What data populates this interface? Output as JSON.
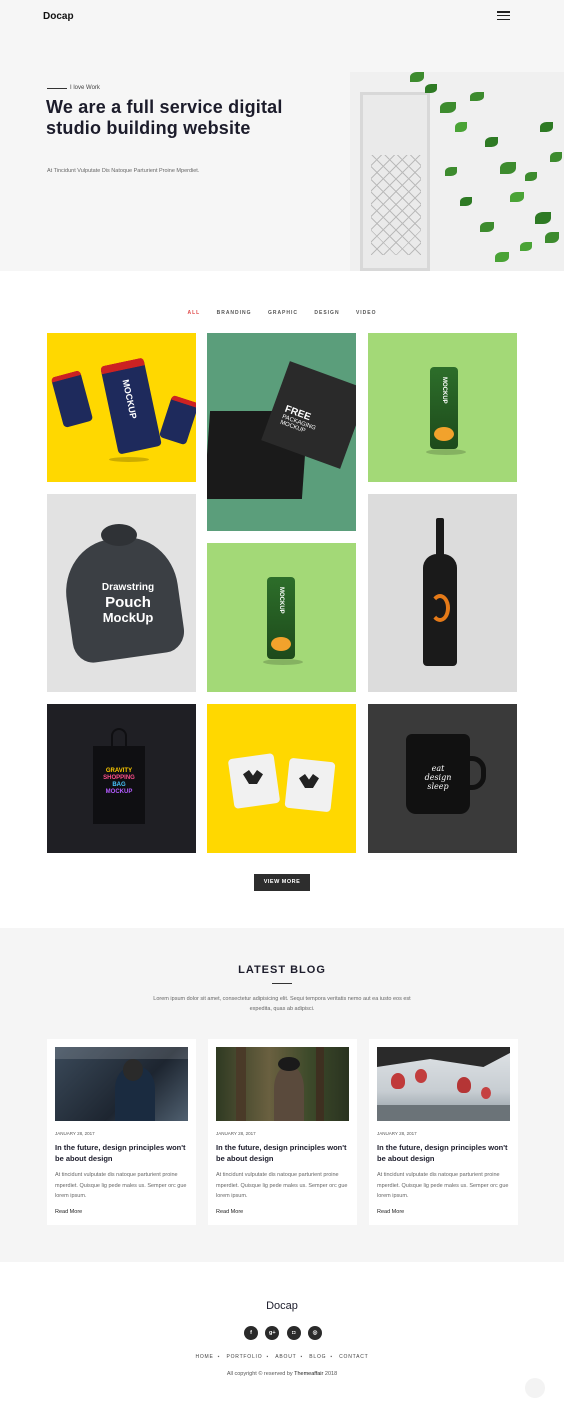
{
  "header": {
    "logo": "Docap",
    "menu_icon": "hamburger-icon"
  },
  "hero": {
    "eyebrow": "I love Work",
    "title": "We are a full service digital studio building website",
    "subtitle": "At Tincidunt Vulputate Dis Natoque Parturient Proine Mperdiet."
  },
  "portfolio": {
    "filters": [
      "ALL",
      "BRANDING",
      "GRAPHIC",
      "DESIGN",
      "VIDEO"
    ],
    "active_filter": "ALL",
    "items": [
      {
        "label_1": "MOCKUP",
        "label_2": "CAN"
      },
      {
        "label_1": "FREE",
        "label_2": "PACKAGING",
        "label_3": "MOCKUP"
      },
      {
        "label_1": "CAN",
        "label_2": "MOCKUP"
      },
      {
        "label_1": "Drawstring",
        "label_2": "Pouch",
        "label_3": "MockUp"
      },
      {
        "label_1": "CAN",
        "label_2": "MOCKUP"
      },
      {
        "label_1": ""
      },
      {
        "label_1": "GRAVITY",
        "label_2": "SHOPPING",
        "label_3": "BAG",
        "label_4": "MOCKUP"
      },
      {
        "label_1": ""
      },
      {
        "label_1": "eat",
        "label_2": "design",
        "label_3": "sleep"
      }
    ],
    "view_more": "VIEW MORE"
  },
  "blog": {
    "title": "LATEST BLOG",
    "description": "Lorem ipsum dolor sit amet, consectetur adipisicing elit. Sequi tempora veritatis nemo aut ea iusto eos est expedita, quas ab adipisci.",
    "posts": [
      {
        "date": "JANUARY 28, 2017",
        "title": "In the future, design principles won't be about design",
        "excerpt": "At tincidunt vulputate dis natoque parturient proine mperdiet. Quisque lig pede males us. Semper orc gue lorem ipsum.",
        "read_more": "Read More"
      },
      {
        "date": "JANUARY 28, 2017",
        "title": "In the future, design principles won't be about design",
        "excerpt": "At tincidunt vulputate dis natoque parturient proine mperdiet. Quisque lig pede males us. Semper orc gue lorem ipsum.",
        "read_more": "Read More"
      },
      {
        "date": "JANUARY 28, 2017",
        "title": "In the future, design principles won't be about design",
        "excerpt": "At tincidunt vulputate dis natoque parturient proine mperdiet. Quisque lig pede males us. Semper orc gue lorem ipsum.",
        "read_more": "Read More"
      }
    ]
  },
  "footer": {
    "logo": "Docap",
    "socials": [
      {
        "icon": "facebook-icon",
        "glyph": "f"
      },
      {
        "icon": "google-plus-icon",
        "glyph": "g+"
      },
      {
        "icon": "instagram-icon",
        "glyph": "◘"
      },
      {
        "icon": "dribbble-icon",
        "glyph": "◎"
      }
    ],
    "nav": [
      "HOME",
      "PORTFOLIO",
      "ABOUT",
      "BLOG",
      "CONTACT"
    ],
    "copyright_prefix": "All copyright © reserved by",
    "copyright_brand": "Themeaffair",
    "copyright_year": "2018"
  },
  "colors": {
    "accent": "#e04848",
    "yellow": "#ffd800",
    "green_light": "#a3d977",
    "green_dark": "#5b9e7b",
    "dark": "#2d2d2d"
  }
}
